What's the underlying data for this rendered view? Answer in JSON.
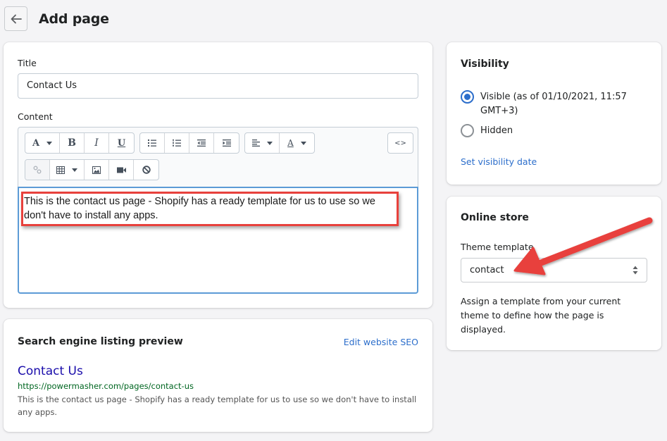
{
  "header": {
    "back_icon": "arrow-left-icon",
    "title": "Add page"
  },
  "main": {
    "title_label": "Title",
    "title_value": "Contact Us",
    "content_label": "Content",
    "toolbar": {
      "row1": [
        {
          "name": "font-format",
          "icon": "A",
          "dropdown": true
        },
        {
          "name": "bold",
          "icon": "B"
        },
        {
          "name": "italic",
          "icon": "I"
        },
        {
          "name": "underline",
          "icon": "U"
        },
        {
          "name": "bulleted-list",
          "icon": "bullet-list-icon"
        },
        {
          "name": "numbered-list",
          "icon": "numbered-list-icon"
        },
        {
          "name": "outdent",
          "icon": "outdent-icon"
        },
        {
          "name": "indent",
          "icon": "indent-icon"
        },
        {
          "name": "align",
          "icon": "align-left-icon",
          "dropdown": true
        },
        {
          "name": "text-color",
          "icon": "A",
          "dropdown": true
        },
        {
          "name": "show-html",
          "icon": "<>"
        }
      ],
      "row2": [
        {
          "name": "link",
          "icon": "link-icon",
          "disabled": true
        },
        {
          "name": "table",
          "icon": "table-icon",
          "dropdown": true
        },
        {
          "name": "image",
          "icon": "image-icon"
        },
        {
          "name": "video",
          "icon": "video-icon"
        },
        {
          "name": "clear-formatting",
          "icon": "block-icon"
        }
      ]
    },
    "content_text": "This is the contact us page - Shopify has a ready template for us to use so we don't have to install any apps."
  },
  "seo": {
    "heading": "Search engine listing preview",
    "edit_link": "Edit website SEO",
    "preview_title": "Contact Us",
    "preview_url": "https://powermasher.com/pages/contact-us",
    "preview_description": "This is the contact us page - Shopify has a ready template for us to use so we don't have to install any apps."
  },
  "visibility": {
    "heading": "Visibility",
    "options": [
      {
        "label": "Visible (as of 01/10/2021, 11:57 GMT+3)",
        "checked": true
      },
      {
        "label": "Hidden",
        "checked": false
      }
    ],
    "set_date_link": "Set visibility date"
  },
  "online_store": {
    "heading": "Online store",
    "theme_template_label": "Theme template",
    "theme_template_value": "contact",
    "help_text": "Assign a template from your current theme to define how the page is displayed."
  },
  "colors": {
    "link": "#2c6ecb",
    "annotation": "#e8413c",
    "seo_title": "#1a0dab",
    "seo_url": "#006621",
    "editor_focus": "#5c9bd6"
  }
}
